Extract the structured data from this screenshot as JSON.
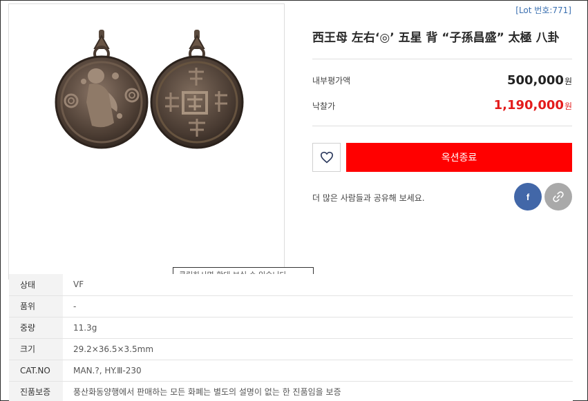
{
  "lot": {
    "number_label": "[Lot 번호:771]"
  },
  "item": {
    "title": "西王母 左右‘◎’ 五星 背 “子孫昌盛” 太極 八卦"
  },
  "image": {
    "tooltip": "클릭하시면 확대 보실 수 있습니다"
  },
  "prices": {
    "estimate_label": "내부평가액",
    "estimate_value": "500,000",
    "hammer_label": "낙찰가",
    "hammer_value": "1,190,000",
    "unit": "원"
  },
  "actions": {
    "wish_icon": "heart-outline-icon",
    "auction_status_label": "옥션종료"
  },
  "share": {
    "text": "더 많은 사람들과 공유해 보세요.",
    "facebook_label": "f",
    "link_icon": "link-icon"
  },
  "specs": [
    {
      "key": "상태",
      "value": "VF"
    },
    {
      "key": "품위",
      "value": "-"
    },
    {
      "key": "중량",
      "value": "11.3g"
    },
    {
      "key": "크기",
      "value": "29.2×36.5×3.5mm"
    },
    {
      "key": "CAT.NO",
      "value": "MAN.?, HY.Ⅲ-230"
    },
    {
      "key": "진품보증",
      "value": "풍산화동양행에서 판매하는 모든 화폐는 별도의 설명이 없는 한 진품임을 보증"
    }
  ],
  "colors": {
    "accent_red": "#ff0000",
    "price_red": "#e31b1b",
    "facebook_blue": "#4267a8",
    "lot_blue": "#3a6fb0"
  }
}
